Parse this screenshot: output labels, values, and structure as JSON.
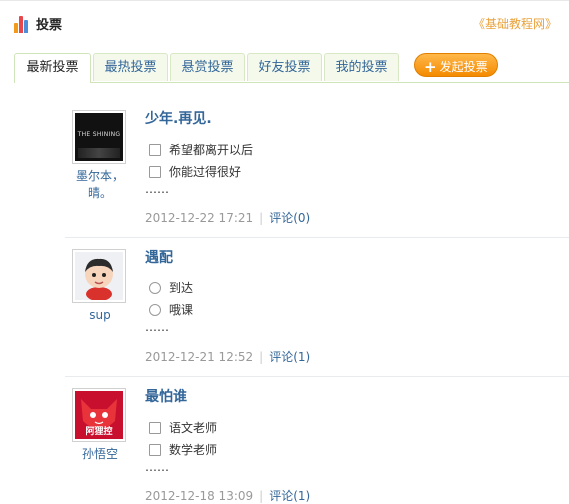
{
  "header": {
    "title": "投票",
    "crumb": "《基础教程网》"
  },
  "tabs": [
    {
      "label": "最新投票",
      "active": true
    },
    {
      "label": "最热投票"
    },
    {
      "label": "悬赏投票"
    },
    {
      "label": "好友投票"
    },
    {
      "label": "我的投票"
    }
  ],
  "launch_label": "发起投票",
  "polls": [
    {
      "user": "墨尔本，晴。",
      "avatar_text": "THE SHINING",
      "title": "少年.再见.",
      "option_type": "checkbox",
      "options": [
        "希望都离开以后",
        "你能过得很好"
      ],
      "ellipsis": "……",
      "date": "2012-12-22 17:21",
      "comments": "评论(0)"
    },
    {
      "user": "sup",
      "title": "遇配",
      "option_type": "radio",
      "options": [
        "到达",
        "哦课"
      ],
      "ellipsis": "……",
      "date": "2012-12-21 12:52",
      "comments": "评论(1)"
    },
    {
      "user": "孙悟空",
      "avatar_text": "阿狸控",
      "title": "最怕谁",
      "option_type": "checkbox",
      "options": [
        "语文老师",
        "数学老师"
      ],
      "ellipsis": "……",
      "date": "2012-12-18 13:09",
      "comments": "评论(1)"
    }
  ]
}
